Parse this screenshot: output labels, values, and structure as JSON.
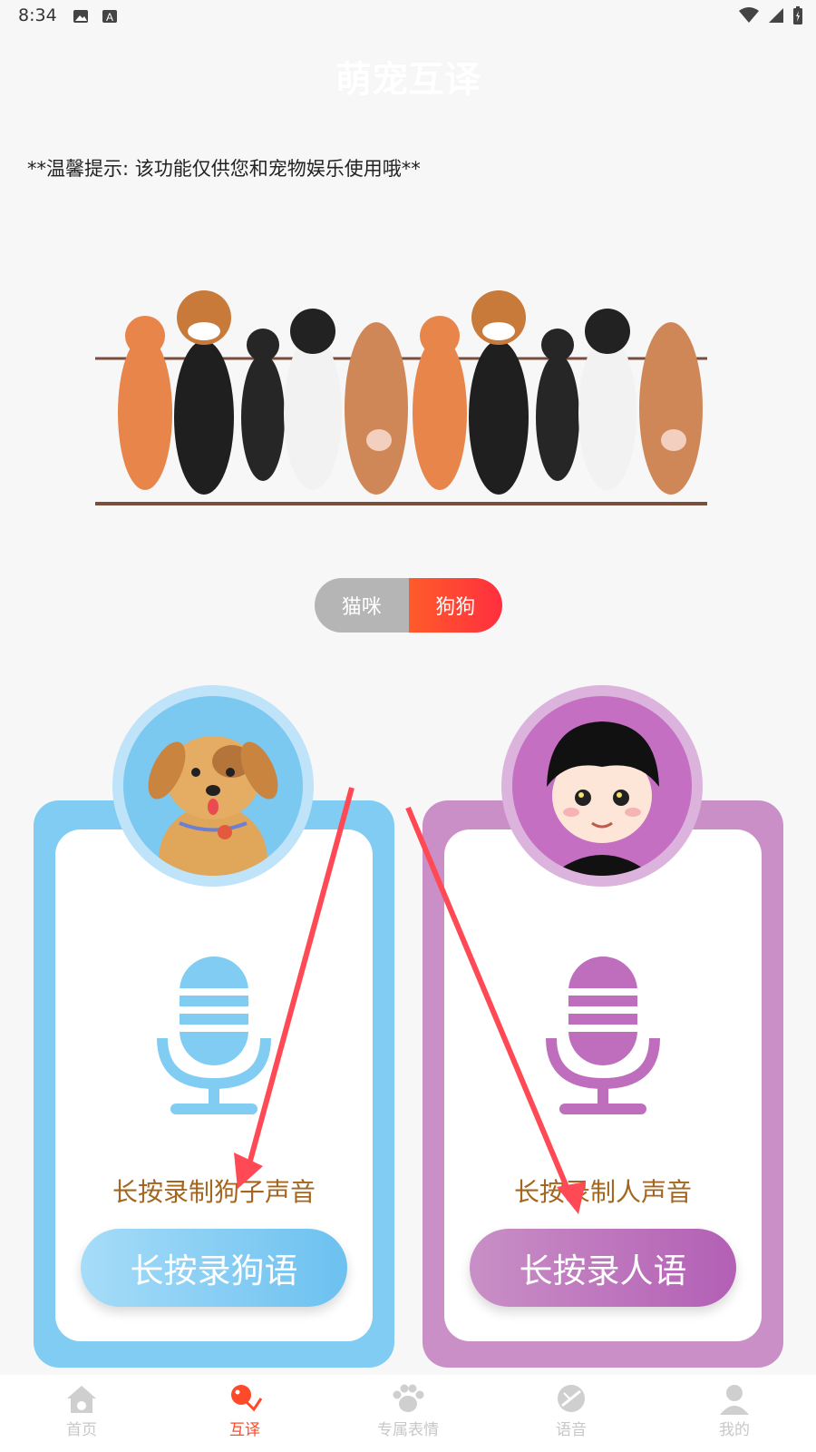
{
  "status_bar": {
    "time": "8:34"
  },
  "app_title": "萌宠互译",
  "tip": "**温馨提示: 该功能仅供您和宠物娱乐使用哦**",
  "toggle": {
    "cat_label": "猫咪",
    "dog_label": "狗狗",
    "selected": "狗狗"
  },
  "cards": {
    "dog": {
      "hint": "长按录制狗子声音",
      "button": "长按录狗语",
      "color": "#80ccf3"
    },
    "human": {
      "hint": "长按录制人声音",
      "button": "长按录人语",
      "color": "#c98fc6"
    }
  },
  "bottom_nav": {
    "items": [
      {
        "label": "首页",
        "icon": "home-icon"
      },
      {
        "label": "互译",
        "icon": "translate-icon",
        "active": true
      },
      {
        "label": "专属表情",
        "icon": "paw-icon"
      },
      {
        "label": "语音",
        "icon": "voice-icon"
      },
      {
        "label": "我的",
        "icon": "profile-icon"
      }
    ]
  },
  "colors": {
    "accent": "#ff4a2a",
    "dog": "#80ccf3",
    "human": "#c98fc6",
    "hint": "#a4651f"
  }
}
